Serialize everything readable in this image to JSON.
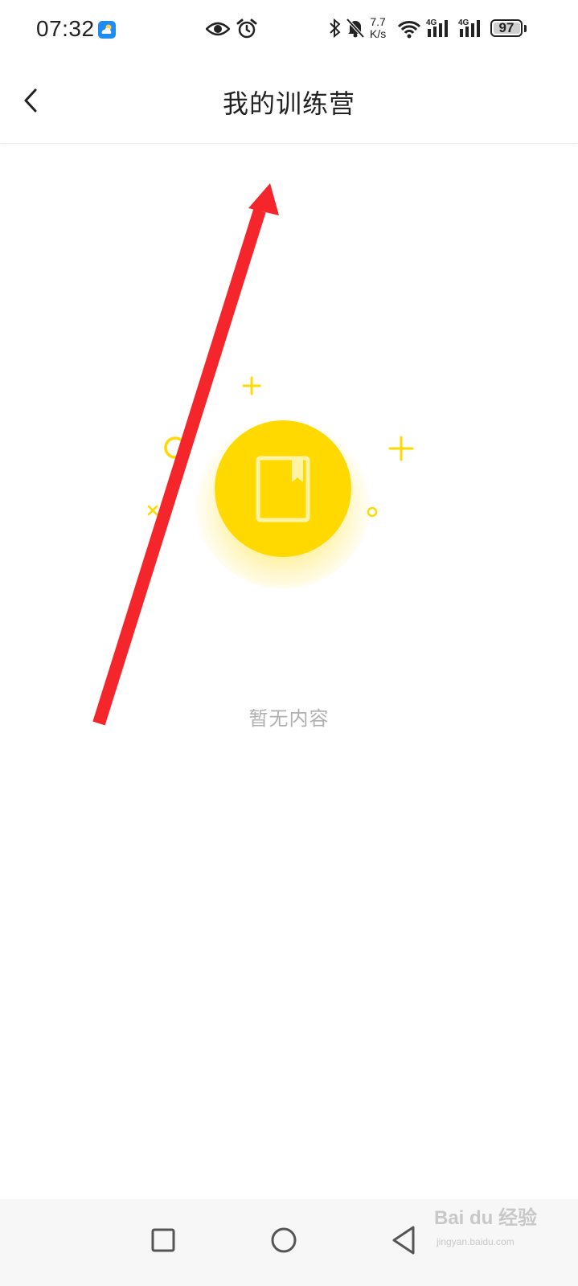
{
  "status_bar": {
    "time": "07:32",
    "net_speed_value": "7.7",
    "net_speed_unit": "K/s",
    "battery_level": "97",
    "icons": [
      "weather-icon",
      "eye-icon",
      "alarm-icon",
      "bluetooth-icon",
      "mute-icon",
      "wifi-icon",
      "signal-4g-icon",
      "signal-4g-icon",
      "battery-icon"
    ]
  },
  "nav": {
    "title": "我的训练营",
    "back_icon": "chevron-left-icon"
  },
  "main": {
    "empty_state_text": "暂无内容",
    "empty_icon": "book-icon",
    "accent_color": "#FFD900"
  },
  "annotation": {
    "arrow_color": "#F5262B"
  },
  "system_nav": {
    "buttons": [
      "recent-apps-icon",
      "home-icon",
      "back-icon"
    ]
  },
  "watermark": {
    "brand": "Bai du 经验",
    "url": "jingyan.baidu.com"
  }
}
